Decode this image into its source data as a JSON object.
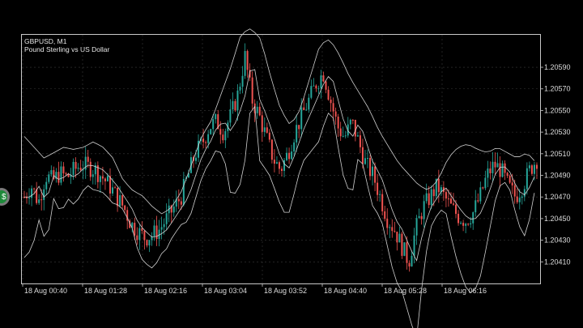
{
  "header": {
    "symbol": "GBPUSD, M1",
    "description": "Pound Sterling vs US Dollar"
  },
  "colors": {
    "background": "#000000",
    "bull": "#26a69a",
    "bear": "#ef5350",
    "bands": "#d0d0d0",
    "grid": "#3a3a3a",
    "frame": "#c8c8c8"
  },
  "chart_data": {
    "type": "candlestick",
    "grid": true,
    "indicators": [
      "bollinger-bands"
    ],
    "ylim": [
      1.2039,
      1.2062
    ],
    "yticks": [
      "1.20590",
      "1.20570",
      "1.20550",
      "1.20530",
      "1.20510",
      "1.20490",
      "1.20470",
      "1.20450",
      "1.20430",
      "1.20410"
    ],
    "xticks": [
      "18 Aug 00:40",
      "18 Aug 01:28",
      "18 Aug 02:16",
      "18 Aug 03:04",
      "18 Aug 03:52",
      "18 Aug 04:40",
      "18 Aug 05:28",
      "18 Aug 06:16"
    ],
    "close_path": [
      1.2047,
      1.2048,
      1.20465,
      1.2049,
      1.20485,
      1.20492,
      1.20488,
      1.20495,
      1.205,
      1.20498,
      1.20495,
      1.20488,
      1.2048,
      1.2047,
      1.2046,
      1.20445,
      1.20438,
      1.20432,
      1.20435,
      1.2044,
      1.2045,
      1.2046,
      1.2047,
      1.2049,
      1.2051,
      1.2052,
      1.20535,
      1.2054,
      1.2053,
      1.20545,
      1.20565,
      1.206,
      1.2056,
      1.20545,
      1.20525,
      1.20505,
      1.20495,
      1.2051,
      1.2053,
      1.20545,
      1.2056,
      1.20575,
      1.20585,
      1.2056,
      1.20535,
      1.20525,
      1.2054,
      1.2052,
      1.205,
      1.2049,
      1.2047,
      1.2045,
      1.2044,
      1.20425,
      1.2041,
      1.2044,
      1.2046,
      1.2047,
      1.2048,
      1.2047,
      1.2046,
      1.20452,
      1.20448,
      1.20455,
      1.2047,
      1.2049,
      1.205,
      1.20495,
      1.2048,
      1.2047,
      1.2048,
      1.20495,
      1.20505
    ],
    "upper_band_path": [
      1.2052,
      1.2051,
      1.205,
      1.20505,
      1.2051,
      1.20508,
      1.2051,
      1.20515,
      1.2051,
      1.205,
      1.2048,
      1.2047,
      1.20465,
      1.20455,
      1.20448,
      1.20455,
      1.2047,
      1.20495,
      1.2052,
      1.20535,
      1.2056,
      1.20585,
      1.20615,
      1.2062,
      1.2061,
      1.20575,
      1.20545,
      1.2053,
      1.20545,
      1.20575,
      1.20605,
      1.2061,
      1.20595,
      1.20575,
      1.2056,
      1.20545,
      1.20525,
      1.2051,
      1.20495,
      1.20485,
      1.20475,
      1.2047,
      1.2048,
      1.205,
      1.2051,
      1.20513,
      1.20508,
      1.20505,
      1.2051,
      1.20505,
      1.205,
      1.20505,
      1.20495
    ]
  },
  "app_button": {
    "label": "$"
  }
}
